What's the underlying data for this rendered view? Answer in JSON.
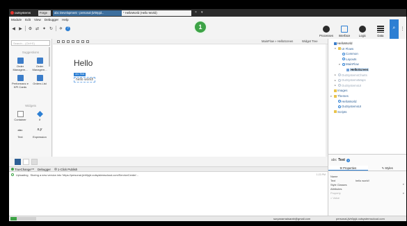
{
  "titlebar": {
    "logo_text": "outsystems",
    "tabs": [
      {
        "label": "Forge"
      },
      {
        "label": "abc Development - personal-jlvh0pjd..."
      },
      {
        "label": "* HelloWorld (Hello World)"
      }
    ],
    "close_glyph": "×",
    "more_glyph": "▾"
  },
  "menu": {
    "items": [
      "Module",
      "Edit",
      "View",
      "Debugger",
      "Help"
    ]
  },
  "toolbar": {
    "icons": [
      "back-icon",
      "forward-icon",
      "settings-icon",
      "compare-icon",
      "debug-icon",
      "refresh-icon",
      "publish-icon",
      "help-icon"
    ],
    "help_glyph": "?"
  },
  "step_badge": "1",
  "areas": [
    {
      "label": "Processes",
      "icon": "processes-icon"
    },
    {
      "label": "Interface",
      "icon": "interface-icon"
    },
    {
      "label": "Logic",
      "icon": "logic-icon"
    },
    {
      "label": "Data",
      "icon": "data-icon"
    }
  ],
  "area_search_glyph": "⌕",
  "area_more_glyph": "⋮",
  "toolbox": {
    "search_placeholder": "Search... (Ctrl+E)",
    "groups": [
      "Suggestions",
      "Widgets"
    ],
    "items": [
      {
        "label": "Order Managem..."
      },
      {
        "label": "Order Managem..."
      },
      {
        "label": "Performanc e KPI Cards"
      },
      {
        "label": "Orders List"
      },
      {
        "label": "Container"
      },
      {
        "label": "If"
      },
      {
        "label": "Text"
      },
      {
        "label": "Expression"
      }
    ],
    "abc_glyph": "abc",
    "xy_glyph": "x.y"
  },
  "canvas": {
    "breadcrumb": "MainFlow » HelloScreen",
    "widget_tree_label": "Widget Tree",
    "title": "Hello",
    "text_tag_prefix": "abc",
    "text_tag_label": "Text",
    "text_value": "hello world!"
  },
  "tree": {
    "items": [
      {
        "label": "HelloWorld",
        "kind": "app",
        "toggle": "",
        "depth": 0,
        "root": true
      },
      {
        "label": "UI Flows",
        "kind": "folder",
        "toggle": "▾",
        "depth": 1
      },
      {
        "label": "Common",
        "kind": "flow",
        "toggle": "",
        "depth": 2
      },
      {
        "label": "Layouts",
        "kind": "flow",
        "toggle": "",
        "depth": 2
      },
      {
        "label": "MainFlow",
        "kind": "flow",
        "toggle": "▾",
        "depth": 2
      },
      {
        "label": "HelloScreen",
        "kind": "screen",
        "toggle": "",
        "depth": 3,
        "selected": true
      },
      {
        "label": "OutSystemsCharts",
        "kind": "dim",
        "toggle": "▸",
        "depth": 1,
        "dim": true
      },
      {
        "label": "OutSystemsMaps",
        "kind": "dim",
        "toggle": "▸",
        "depth": 1,
        "dim": true
      },
      {
        "label": "OutSystemsUI",
        "kind": "dim",
        "toggle": "▸",
        "depth": 1,
        "dim": true
      },
      {
        "label": "Images",
        "kind": "folder",
        "toggle": "",
        "depth": 0
      },
      {
        "label": "Themes",
        "kind": "folder",
        "toggle": "▾",
        "depth": 0
      },
      {
        "label": "HelloWorld",
        "kind": "flow",
        "toggle": "",
        "depth": 1
      },
      {
        "label": "OutSystemsUI",
        "kind": "flow",
        "toggle": "",
        "depth": 1
      },
      {
        "label": "Scripts",
        "kind": "folder",
        "toggle": "",
        "depth": 0
      }
    ]
  },
  "properties": {
    "abc_glyph": "abc",
    "widget": "Text",
    "help_glyph": "?",
    "tab_properties": "Properties",
    "tab_styles": "Styles",
    "tab_properties_icon": "⚒",
    "tab_styles_icon": "✎",
    "rows": [
      {
        "key": "Name",
        "value": "",
        "muted": false,
        "dropdown": ""
      },
      {
        "key": "Text",
        "value": "hello world!",
        "muted": false,
        "dropdown": ""
      },
      {
        "key": "Style Classes",
        "value": "",
        "muted": false,
        "dropdown": "▾"
      },
      {
        "key": "Attributes",
        "value": "",
        "muted": false,
        "dropdown": ""
      },
      {
        "key": "Property",
        "value": "",
        "muted": true,
        "dropdown": "▾"
      },
      {
        "key": "= Value",
        "value": "",
        "muted": true,
        "dropdown": ""
      }
    ]
  },
  "output": {
    "tabs": [
      {
        "label": "TrueChange™",
        "dot": "green"
      },
      {
        "label": "Debugger",
        "dot": ""
      },
      {
        "label": "1-Click Publish",
        "dot": "gray"
      }
    ],
    "status": "Uploading",
    "message": "Storing a new version into 'https://personal-jlvh0pjd.outsystemscloud.com/ServiceCenter'...",
    "time": "1:23 PM"
  },
  "statusbar": {
    "progress": 0.25,
    "user": "suryanarnaisarah@gmail.com",
    "server": "personal-jlvh0pjd.outsystemscloud.com"
  },
  "colors": {
    "accent": "#2d7fd3",
    "success": "#3da346",
    "brand": "#e4312b",
    "titlebar": "#2b2b2b"
  }
}
